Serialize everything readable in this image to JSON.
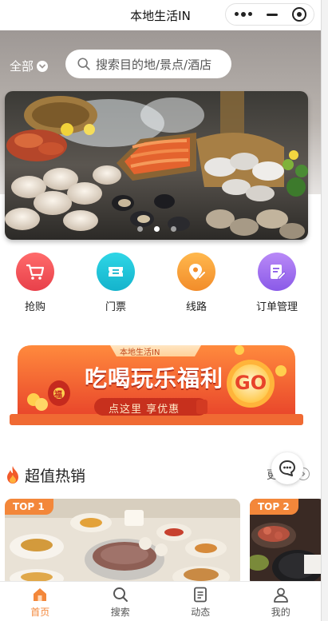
{
  "window": {
    "title": "本地生活IN"
  },
  "capsule": {
    "more_icon": "three-dots-icon",
    "minimize_icon": "minus-icon",
    "close_icon": "target-ring-icon"
  },
  "header": {
    "region_label": "全部",
    "search_placeholder": "搜索目的地/景点/酒店"
  },
  "banner": {
    "slides_total": 3,
    "active_index": 2
  },
  "quick_links": [
    {
      "label": "抢购",
      "icon": "cart-icon",
      "color": "#f2555a"
    },
    {
      "label": "门票",
      "icon": "ticket-icon",
      "color": "#1fc3d8"
    },
    {
      "label": "线路",
      "icon": "map-pin-icon",
      "color": "#f7a13f"
    },
    {
      "label": "订单管理",
      "icon": "order-edit-icon",
      "color": "#9b6cf2"
    }
  ],
  "promo": {
    "tag": "本地生活IN",
    "headline": "吃喝玩乐福利",
    "subline": "点这里 享优惠",
    "badge": "GO",
    "bag_text": "福"
  },
  "hot": {
    "title": "超值热销",
    "more_label": "更多",
    "cards": [
      {
        "rank": "TOP 1"
      },
      {
        "rank": "TOP 2"
      }
    ]
  },
  "tabbar": {
    "items": [
      {
        "label": "首页",
        "icon": "home-icon",
        "active": true
      },
      {
        "label": "搜索",
        "icon": "search-icon",
        "active": false
      },
      {
        "label": "动态",
        "icon": "document-icon",
        "active": false
      },
      {
        "label": "我的",
        "icon": "person-icon",
        "active": false
      }
    ]
  },
  "colors": {
    "accent": "#f3873a",
    "promo_red": "#e8432a"
  }
}
